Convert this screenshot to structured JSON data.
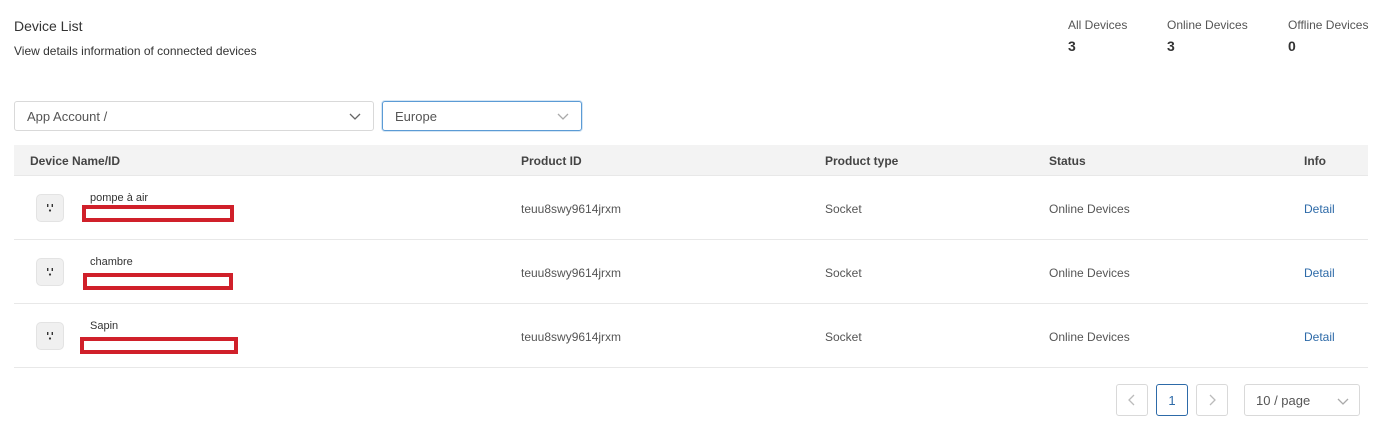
{
  "header": {
    "title": "Device List",
    "subtitle": "View details information of connected devices"
  },
  "stats": [
    {
      "label": "All Devices",
      "value": "3"
    },
    {
      "label": "Online Devices",
      "value": "3"
    },
    {
      "label": "Offline Devices",
      "value": "0"
    }
  ],
  "filters": {
    "account": "App Account /",
    "region": "Europe"
  },
  "table": {
    "columns": [
      "Device Name/ID",
      "Product ID",
      "Product type",
      "Status",
      "Info"
    ],
    "rows": [
      {
        "name": "pompe à air",
        "product_id": "teuu8swy9614jrxm",
        "type": "Socket",
        "status": "Online Devices",
        "info": "Detail"
      },
      {
        "name": "chambre",
        "product_id": "teuu8swy9614jrxm",
        "type": "Socket",
        "status": "Online Devices",
        "info": "Detail"
      },
      {
        "name": "Sapin",
        "product_id": "teuu8swy9614jrxm",
        "type": "Socket",
        "status": "Online Devices",
        "info": "Detail"
      }
    ]
  },
  "pagination": {
    "prev": "<",
    "current": "1",
    "next": ">",
    "page_size": "10 / page"
  },
  "icons": {
    "device": "socket-icon",
    "dropdown": "chevron-down-icon"
  },
  "colors": {
    "link": "#2d6aa8",
    "redaction": "#d0202a"
  }
}
